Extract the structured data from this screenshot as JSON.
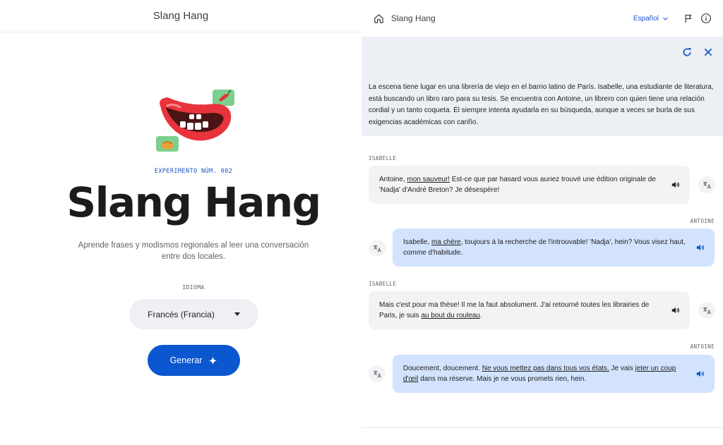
{
  "left": {
    "header_title": "Slang Hang",
    "experiment_label": "EXPERIMENTO NÚM. 002",
    "title": "Slang Hang",
    "subtitle": "Aprende frases y modismos regionales al leer una conversación entre dos locales.",
    "language_label": "IDIOMA",
    "language_value": "Francés (Francia)",
    "generate_label": "Generar"
  },
  "right": {
    "brand": "Slang Hang",
    "language": "Español",
    "scene_text": "La escena tiene lugar en una librería de viejo en el barrio latino de París. Isabelle, una estudiante de literatura, está buscando un libro raro para su tesis. Se encuentra con Antoine, un librero con quien tiene una relación cordial y un tanto coqueta. Él siempre intenta ayudarla en su búsqueda, aunque a veces se burla de sus exigencias académicas con cariño.",
    "messages": [
      {
        "speaker": "ISABELLE",
        "parts": [
          "Antoine, ",
          "mon sauveur!",
          " Est-ce que par hasard vous auriez trouvé une édition originale de 'Nadja' d'André Breton? Je désespère!"
        ]
      },
      {
        "speaker": "ANTOINE",
        "parts": [
          "Isabelle, ",
          "ma chère",
          ", toujours à la recherche de l'introuvable! 'Nadja', hein? Vous visez haut, comme d'habitude."
        ]
      },
      {
        "speaker": "ISABELLE",
        "parts": [
          "Mais c'est pour ma thèse! Il me la faut absolument. J'ai retourné toutes les librairies de Paris, je suis ",
          "au bout du rouleau",
          "."
        ]
      },
      {
        "speaker": "ANTOINE",
        "parts": [
          "Doucement, doucement. ",
          "Ne vous mettez pas dans tous vos états.",
          " Je vais ",
          "jeter un coup d'œil",
          " dans ma réserve. Mais je ne vous promets rien, hein."
        ]
      }
    ]
  },
  "icons": {
    "home": "home-icon",
    "chevron": "chevron-down-icon",
    "flag": "flag-icon",
    "info": "info-icon",
    "refresh": "refresh-icon",
    "close": "close-icon",
    "speaker": "speaker-icon",
    "translate": "translate-icon",
    "sparkle": "sparkle-icon"
  },
  "colors": {
    "accent": "#0b57d0",
    "link_blue": "#1a56c9",
    "scene_bg": "#eceff4",
    "isabelle_bubble": "#f1f3f5",
    "antoine_bubble": "#d3e3fd"
  }
}
